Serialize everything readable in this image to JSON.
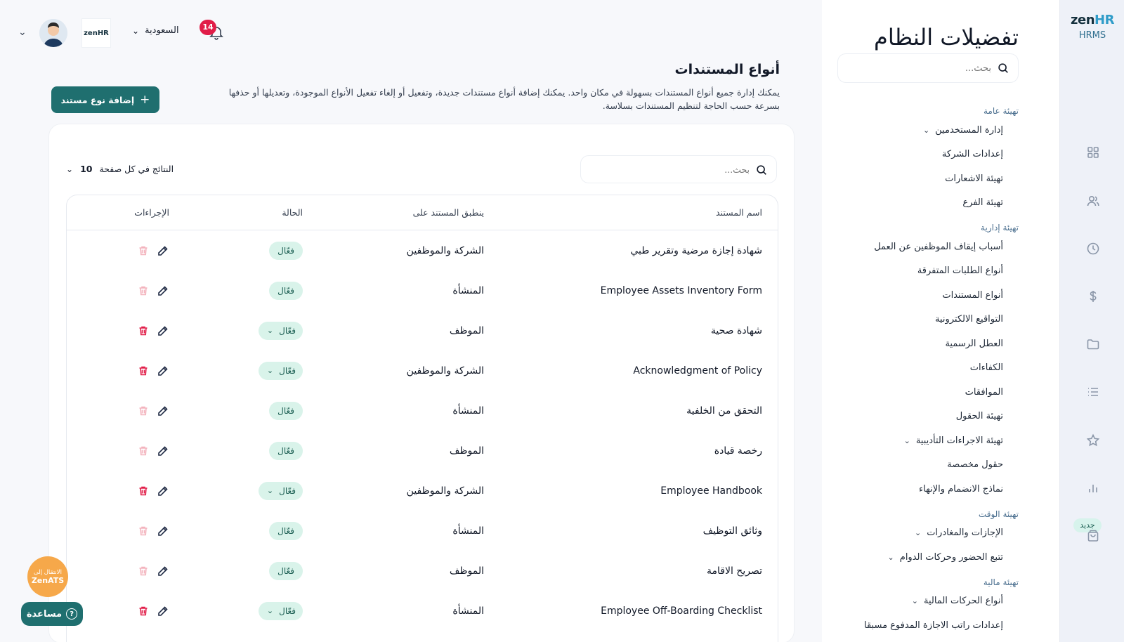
{
  "brand": {
    "logo_main": "zen",
    "logo_accent": "HR",
    "product": "HRMS",
    "new_badge": "جديد"
  },
  "header": {
    "country": "السعودية",
    "notifications_count": "14",
    "company_logo": "zenHR"
  },
  "settings": {
    "title": "تفضيلات النظام",
    "search_placeholder": "بحث...",
    "nav": [
      {
        "type": "group",
        "label": "تهيئة عامة"
      },
      {
        "type": "item",
        "label": "إدارة المستخدمين",
        "expandable": true
      },
      {
        "type": "item",
        "label": "إعدادات الشركة"
      },
      {
        "type": "item",
        "label": "تهيئة الاشعارات"
      },
      {
        "type": "item",
        "label": "تهيئة الفرع"
      },
      {
        "type": "group",
        "label": "تهيئة إدارية"
      },
      {
        "type": "item",
        "label": "أسباب إيقاف الموظفين عن العمل"
      },
      {
        "type": "item",
        "label": "أنواع الطلبات المتفرقة"
      },
      {
        "type": "item",
        "label": "أنواع المستندات",
        "active": true
      },
      {
        "type": "item",
        "label": "التواقيع الالكترونية"
      },
      {
        "type": "item",
        "label": "العطل الرسمية"
      },
      {
        "type": "item",
        "label": "الكفاءات"
      },
      {
        "type": "item",
        "label": "الموافقات"
      },
      {
        "type": "item",
        "label": "تهيئة الحقول"
      },
      {
        "type": "item",
        "label": "تهيئة الاجراءات التأديبية",
        "expandable": true
      },
      {
        "type": "item",
        "label": "حقول مخصصة"
      },
      {
        "type": "item",
        "label": "نماذج الانضمام والإنهاء"
      },
      {
        "type": "group",
        "label": "تهيئة الوقت"
      },
      {
        "type": "item",
        "label": "الإجازات والمغادرات",
        "expandable": true
      },
      {
        "type": "item",
        "label": "تتبع الحضور وحركات الدوام",
        "expandable": true
      },
      {
        "type": "group",
        "label": "تهيئة مالية"
      },
      {
        "type": "item",
        "label": "أنواع الحركات المالية",
        "expandable": true
      },
      {
        "type": "item",
        "label": "إعدادات راتب الاجازة المدفوع مسبقا"
      }
    ]
  },
  "page": {
    "title": "أنواع المستندات",
    "description": "يمكنك إدارة جميع أنواع المستندات بسهولة في مكان واحد. يمكنك إضافة أنواع مستندات جديدة، وتفعيل أو إلغاء تفعيل الأنواع الموجودة، وتعديلها أو حذفها بسرعة حسب الحاجة لتنظيم المستندات بسلاسة.",
    "add_button": "إضافة نوع مستند",
    "per_page_label": "النتائج في كل صفحة",
    "per_page_value": "10",
    "search_placeholder": "بحث..."
  },
  "table": {
    "columns": {
      "name": "اسم المستند",
      "applies_to": "ينطبق المستند على",
      "status": "الحالة",
      "actions": "الإجراءات"
    },
    "rows": [
      {
        "name": "شهادة إجازة مرضية وتقرير طبي",
        "applies_to": "الشركة والموظفين",
        "status": "فعّال",
        "status_dropdown": false,
        "deletable": false
      },
      {
        "name": "Employee Assets Inventory Form",
        "applies_to": "المنشأة",
        "status": "فعّال",
        "status_dropdown": false,
        "deletable": false
      },
      {
        "name": "شهادة صحية",
        "applies_to": "الموظف",
        "status": "فعّال",
        "status_dropdown": true,
        "deletable": true
      },
      {
        "name": "Acknowledgment of Policy",
        "applies_to": "الشركة والموظفين",
        "status": "فعّال",
        "status_dropdown": true,
        "deletable": true
      },
      {
        "name": "التحقق من الخلفية",
        "applies_to": "المنشأة",
        "status": "فعّال",
        "status_dropdown": false,
        "deletable": false
      },
      {
        "name": "رخصة قيادة",
        "applies_to": "الموظف",
        "status": "فعّال",
        "status_dropdown": false,
        "deletable": false
      },
      {
        "name": "Employee Handbook",
        "applies_to": "الشركة والموظفين",
        "status": "فعّال",
        "status_dropdown": true,
        "deletable": true
      },
      {
        "name": "وثائق التوظيف",
        "applies_to": "المنشأة",
        "status": "فعّال",
        "status_dropdown": false,
        "deletable": false
      },
      {
        "name": "تصريح الاقامة",
        "applies_to": "الموظف",
        "status": "فعّال",
        "status_dropdown": false,
        "deletable": false
      },
      {
        "name": "Employee Off-Boarding Checklist",
        "applies_to": "المنشأة",
        "status": "فعّال",
        "status_dropdown": true,
        "deletable": true
      }
    ]
  },
  "floating": {
    "zenats_line1": "الانتقال إلى",
    "zenats_line2": "ZenATS",
    "help": "مساعدة"
  },
  "colors": {
    "primary": "#1f6f6f",
    "status_bg": "#d9f3ea",
    "danger": "#e11d48",
    "badge": "#e11d48"
  }
}
